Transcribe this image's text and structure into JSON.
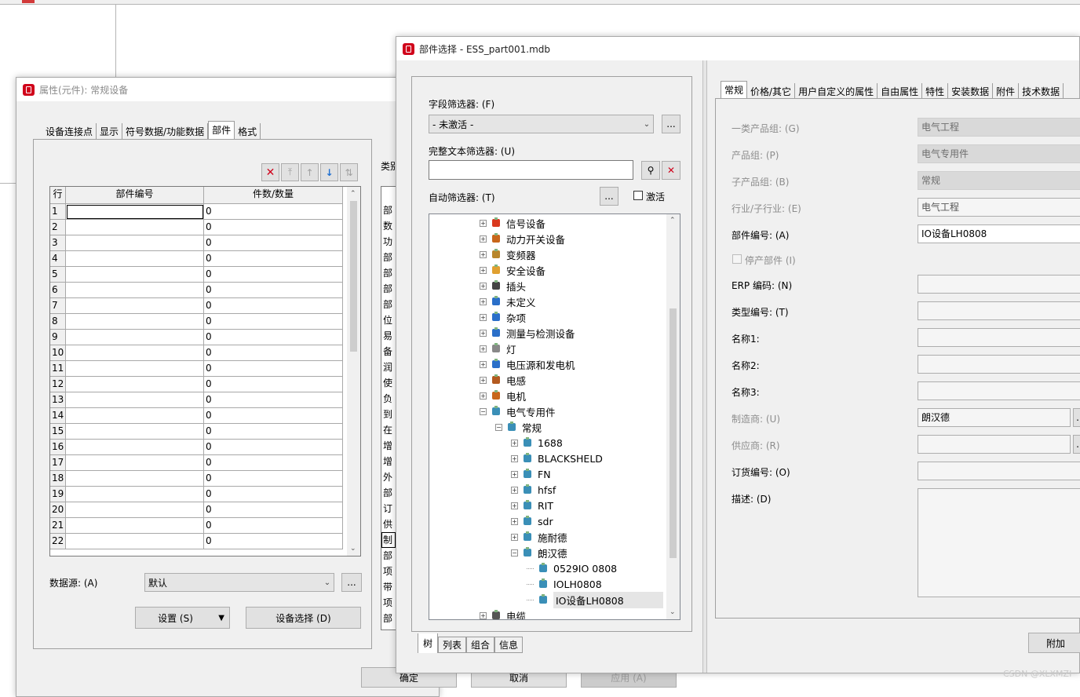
{
  "background_app": {},
  "properties_dialog": {
    "title": "属性(元件): 常规设备",
    "tabs": [
      "设备连接点",
      "显示",
      "符号数据/功能数据",
      "部件",
      "格式"
    ],
    "toolbar_icons": [
      "delete-icon",
      "move-top-icon",
      "move-up-icon",
      "move-down-icon",
      "sort-icon"
    ],
    "grid": {
      "columns": [
        "行",
        "部件编号",
        "件数/数量"
      ],
      "rows": [
        {
          "n": "1",
          "part": "",
          "qty": "0"
        },
        {
          "n": "2",
          "part": "",
          "qty": "0"
        },
        {
          "n": "3",
          "part": "",
          "qty": "0"
        },
        {
          "n": "4",
          "part": "",
          "qty": "0"
        },
        {
          "n": "5",
          "part": "",
          "qty": "0"
        },
        {
          "n": "6",
          "part": "",
          "qty": "0"
        },
        {
          "n": "7",
          "part": "",
          "qty": "0"
        },
        {
          "n": "8",
          "part": "",
          "qty": "0"
        },
        {
          "n": "9",
          "part": "",
          "qty": "0"
        },
        {
          "n": "10",
          "part": "",
          "qty": "0"
        },
        {
          "n": "11",
          "part": "",
          "qty": "0"
        },
        {
          "n": "12",
          "part": "",
          "qty": "0"
        },
        {
          "n": "13",
          "part": "",
          "qty": "0"
        },
        {
          "n": "14",
          "part": "",
          "qty": "0"
        },
        {
          "n": "15",
          "part": "",
          "qty": "0"
        },
        {
          "n": "16",
          "part": "",
          "qty": "0"
        },
        {
          "n": "17",
          "part": "",
          "qty": "0"
        },
        {
          "n": "18",
          "part": "",
          "qty": "0"
        },
        {
          "n": "19",
          "part": "",
          "qty": "0"
        },
        {
          "n": "20",
          "part": "",
          "qty": "0"
        },
        {
          "n": "21",
          "part": "",
          "qty": "0"
        },
        {
          "n": "22",
          "part": "",
          "qty": "0"
        }
      ]
    },
    "side_label": "类别",
    "side_items": [
      "部",
      "数",
      "功",
      "部",
      "部",
      "部",
      "部",
      "位",
      "易",
      "备",
      "润",
      "使",
      "负",
      "到",
      "在",
      "增",
      "增",
      "外",
      "部",
      "订",
      "供",
      "制",
      "部",
      "项",
      "带",
      "项",
      "部"
    ],
    "datasource_label": "数据源: (A)",
    "datasource_value": "默认",
    "settings_button": "设置 (S)",
    "device_select_button": "设备选择 (D)",
    "ok_button": "确定",
    "cancel_button": "取消",
    "apply_button": "应用 (A)"
  },
  "parts_dialog": {
    "title": "部件选择 - ESS_part001.mdb",
    "field_filter_label": "字段筛选器: (F)",
    "field_filter_value": "- 未激活 -",
    "fulltext_filter_label": "完整文本筛选器: (U)",
    "fulltext_filter_value": "",
    "auto_filter_label": "自动筛选器: (T)",
    "activate_label": "激活",
    "more_label": "...",
    "tree": [
      {
        "label": "信号设备",
        "level": 0,
        "exp": "+",
        "icon": "signal-device-icon",
        "color": "#d9381e"
      },
      {
        "label": "动力开关设备",
        "level": 0,
        "exp": "+",
        "icon": "power-switch-icon",
        "color": "#c8661a"
      },
      {
        "label": "变频器",
        "level": 0,
        "exp": "+",
        "icon": "inverter-icon",
        "color": "#b8862b"
      },
      {
        "label": "安全设备",
        "level": 0,
        "exp": "+",
        "icon": "safety-device-icon",
        "color": "#e0a030"
      },
      {
        "label": "插头",
        "level": 0,
        "exp": "+",
        "icon": "plug-icon",
        "color": "#444444"
      },
      {
        "label": "未定义",
        "level": 0,
        "exp": "+",
        "icon": "question-icon",
        "color": "#2a6fc9"
      },
      {
        "label": "杂项",
        "level": 0,
        "exp": "+",
        "icon": "misc-icon",
        "color": "#2a6fc9"
      },
      {
        "label": "测量与检测设备",
        "level": 0,
        "exp": "+",
        "icon": "measurement-icon",
        "color": "#2a6fc9"
      },
      {
        "label": "灯",
        "level": 0,
        "exp": "+",
        "icon": "lamp-icon",
        "color": "#888888"
      },
      {
        "label": "电压源和发电机",
        "level": 0,
        "exp": "+",
        "icon": "voltage-source-icon",
        "color": "#2a6fc9"
      },
      {
        "label": "电感",
        "level": 0,
        "exp": "+",
        "icon": "inductor-icon",
        "color": "#b35a1f"
      },
      {
        "label": "电机",
        "level": 0,
        "exp": "+",
        "icon": "motor-icon",
        "color": "#c8661a"
      },
      {
        "label": "电气专用件",
        "level": 0,
        "exp": "-",
        "icon": "electrical-part-icon",
        "color": "#3a8fb7"
      },
      {
        "label": "常规",
        "level": 1,
        "exp": "-",
        "icon": "electrical-part-icon",
        "color": "#3a8fb7"
      },
      {
        "label": "1688",
        "level": 2,
        "exp": "+",
        "icon": "electrical-part-icon",
        "color": "#3a8fb7"
      },
      {
        "label": "BLACKSHELD",
        "level": 2,
        "exp": "+",
        "icon": "electrical-part-icon",
        "color": "#3a8fb7"
      },
      {
        "label": "FN",
        "level": 2,
        "exp": "+",
        "icon": "electrical-part-icon",
        "color": "#3a8fb7"
      },
      {
        "label": "hfsf",
        "level": 2,
        "exp": "+",
        "icon": "electrical-part-icon",
        "color": "#3a8fb7"
      },
      {
        "label": "RIT",
        "level": 2,
        "exp": "+",
        "icon": "electrical-part-icon",
        "color": "#3a8fb7"
      },
      {
        "label": "sdr",
        "level": 2,
        "exp": "+",
        "icon": "electrical-part-icon",
        "color": "#3a8fb7"
      },
      {
        "label": "施耐德",
        "level": 2,
        "exp": "+",
        "icon": "electrical-part-icon",
        "color": "#3a8fb7"
      },
      {
        "label": "朗汉德",
        "level": 2,
        "exp": "-",
        "icon": "electrical-part-icon",
        "color": "#3a8fb7"
      },
      {
        "label": "0529IO 0808",
        "level": 3,
        "exp": "",
        "icon": "electrical-part-icon",
        "color": "#3a8fb7"
      },
      {
        "label": "IOLH0808",
        "level": 3,
        "exp": "",
        "icon": "electrical-part-icon",
        "color": "#3a8fb7"
      },
      {
        "label": "IO设备LH0808",
        "level": 3,
        "exp": "",
        "icon": "electrical-part-icon",
        "color": "#3a8fb7",
        "selected": true
      },
      {
        "label": "电缆",
        "level": 0,
        "exp": "+",
        "icon": "cable-icon",
        "color": "#555555"
      }
    ],
    "bottom_tabs": [
      "树",
      "列表",
      "组合",
      "信息"
    ],
    "prop_tabs": [
      "常规",
      "价格/其它",
      "用户自定义的属性",
      "自由属性",
      "特性",
      "安装数据",
      "附件",
      "技术数据"
    ],
    "props": {
      "product_group1_label": "一类产品组: (G)",
      "product_group1_value": "电气工程",
      "product_group_label": "产品组: (P)",
      "product_group_value": "电气专用件",
      "sub_product_group_label": "子产品组: (B)",
      "sub_product_group_value": "常规",
      "industry_label": "行业/子行业: (E)",
      "industry_value": "电气工程",
      "part_number_label": "部件编号: (A)",
      "part_number_value": "IO设备LH0808",
      "discontinued_label": "停产部件 (I)",
      "erp_label": "ERP 编码: (N)",
      "type_label": "类型编号: (T)",
      "name1_label": "名称1:",
      "name2_label": "名称2:",
      "name3_label": "名称3:",
      "manufacturer_label": "制造商: (U)",
      "manufacturer_value": "朗汉德",
      "supplier_label": "供应商: (R)",
      "order_no_label": "订货编号: (O)",
      "desc_label": "描述: (D)"
    },
    "attach_button": "附加"
  },
  "watermark": "CSDN @XLXMZI"
}
